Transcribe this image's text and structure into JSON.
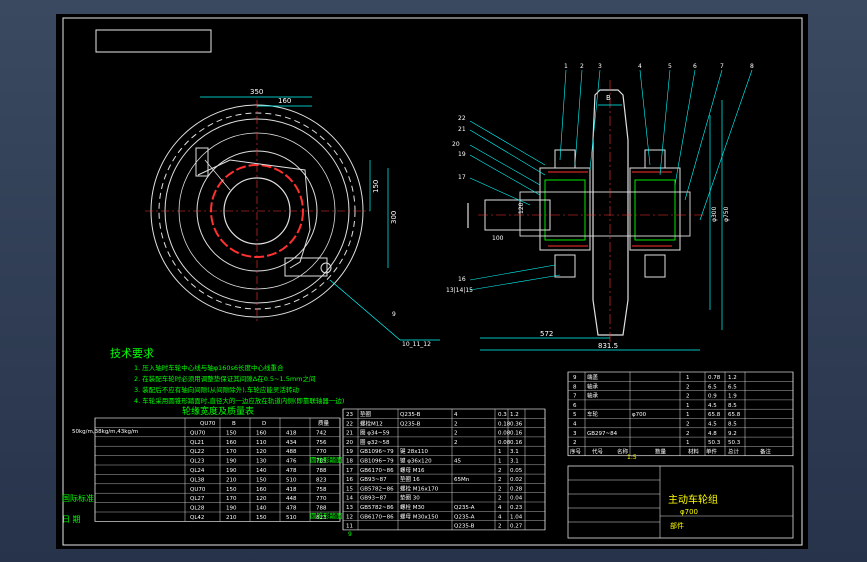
{
  "dims": {
    "d350": "350",
    "d160": "160",
    "d150": "150",
    "d300": "300",
    "d572": "572",
    "d831": "831.5",
    "dB": "B",
    "d100": "100",
    "d120": "120",
    "d130": "130",
    "d300b": "φ300",
    "d750": "φ750",
    "leaders_left": [
      "9",
      "10_11_12"
    ],
    "leaders_right_top": [
      "1",
      "2",
      "3",
      "4",
      "5",
      "6",
      "7",
      "8"
    ],
    "leaders_right_side": [
      "22",
      "21",
      "20",
      "19",
      "18",
      "17",
      "16",
      "13|14|15"
    ]
  },
  "tech": {
    "title": "技术要求",
    "items": [
      "1. 压入轴时车轮中心线与轴φ160s6长度中心线重合",
      "2. 在装配车轮时必须用调整垫保证其间隙Δ在0.5~1.5mm之间",
      "3. 装配后不应有轴向间隙(从间隙除外),车轮应能灵活转动",
      "4. 车轮采用圆锥形踏面时,直径大的一边应放在轨道内侧(即靠联轴器一边)"
    ]
  },
  "wheel_table": {
    "title": "轮缘宽度及质量表",
    "header": [
      "50kg/m,38kg/m,43kg/m",
      "QU70",
      "QL21",
      "宽度",
      "B",
      "D",
      "质量"
    ],
    "rows": [
      [
        "QU70",
        "150",
        "160",
        "418",
        "742"
      ],
      [
        "QL21",
        "160",
        "110",
        "434",
        "756"
      ],
      [
        "QL22",
        "170",
        "120",
        "488",
        "770"
      ],
      [
        "QL23",
        "190",
        "130",
        "476",
        "785"
      ],
      [
        "QL24",
        "190",
        "140",
        "478",
        "788"
      ],
      [
        "QL38",
        "210",
        "150",
        "510",
        "823"
      ],
      [
        "QU70",
        "150",
        "160",
        "418",
        "758"
      ],
      [
        "QL27",
        "170",
        "120",
        "448",
        "770"
      ],
      [
        "QL28",
        "190",
        "140",
        "478",
        "788"
      ],
      [
        "QL42",
        "210",
        "150",
        "510",
        "823"
      ]
    ],
    "side_labels": [
      "圆柱形踏面",
      "圆锥形踏面"
    ],
    "left_labels": [
      "国际标准",
      "日 期"
    ]
  },
  "parts": {
    "rows": [
      [
        "23",
        "垫圈",
        "Q235-B",
        "4",
        "0.3",
        "1.2"
      ],
      [
        "22",
        "螺栓M12",
        "Q235-B",
        "2",
        "0.18",
        "0.36"
      ],
      [
        "21",
        "圈 φ34~59",
        "",
        "2",
        "0.08",
        "0.16"
      ],
      [
        "20",
        "圈 φ32~58",
        "",
        "2",
        "0.08",
        "0.16"
      ],
      [
        "19",
        "GB1096~79",
        "键 28x110",
        "",
        "1",
        "3.1"
      ],
      [
        "18",
        "GB1096~79",
        "键 φ36x120",
        "45",
        "1",
        "3.1"
      ],
      [
        "17",
        "GB6170~86",
        "螺母 M16",
        "",
        "2",
        "0.05"
      ],
      [
        "16",
        "GB93~87",
        "垫圈 16",
        "65Mn",
        "2",
        "0.02"
      ],
      [
        "15",
        "GB5782~86",
        "螺栓 M16x170",
        "",
        "2",
        "0.28"
      ],
      [
        "14",
        "GB93~87",
        "垫圈 30",
        "",
        "2",
        "0.04"
      ],
      [
        "13",
        "GB5782~86",
        "螺栓 M30",
        "Q235-A",
        "4",
        "0.23"
      ],
      [
        "12",
        "GB6170~86",
        "螺母 M30x150",
        "Q235-A",
        "4",
        "1.04"
      ],
      [
        "11",
        "",
        "",
        "Q235-B",
        "2",
        "0.27"
      ]
    ],
    "upper_rows": [
      [
        "9",
        "端盖",
        "",
        "1",
        "0.78",
        "1.2"
      ],
      [
        "8",
        "轴承",
        "",
        "2",
        "6.5",
        "6.5"
      ],
      [
        "7",
        "轴承",
        "",
        "2",
        "0.9",
        "1.9"
      ],
      [
        "6",
        "",
        "",
        "1",
        "4.5",
        "8.5"
      ],
      [
        "5",
        "车轮",
        "φ700",
        "1",
        "65.8",
        "65.8"
      ],
      [
        "4",
        "",
        "",
        "2",
        "4.5",
        "8.5"
      ],
      [
        "3",
        "GB297~84",
        "",
        "2",
        "4.8",
        "9.2"
      ],
      [
        "2",
        "",
        "",
        "1",
        "50.3",
        "50.3"
      ]
    ],
    "header_labels": [
      "序号",
      "代号",
      "名称",
      "数量",
      "材料",
      "单件",
      "总计",
      "备注"
    ]
  },
  "title_block": {
    "title": "主动车轮组",
    "subtitle": "φ700",
    "label": "部件",
    "scale": "1:5",
    "page": "9"
  }
}
